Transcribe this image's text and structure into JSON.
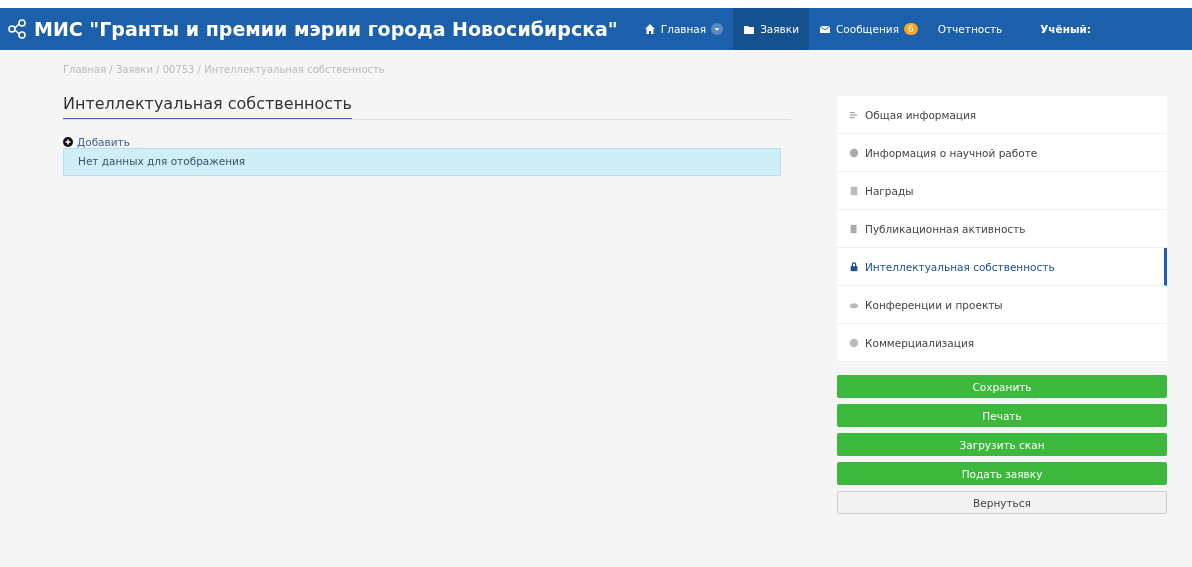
{
  "header": {
    "title": "МИС \"Гранты и премии мэрии города Новосибирска\"",
    "nav": [
      {
        "label": "Главная",
        "selected": false,
        "dropdown": true
      },
      {
        "label": "Заявки",
        "selected": true,
        "dropdown": false
      },
      {
        "label": "Сообщения",
        "selected": false,
        "dropdown": false,
        "badge": "6"
      },
      {
        "label": "Отчетность",
        "selected": false,
        "dropdown": false
      }
    ],
    "user": "Учёный:"
  },
  "breadcrumb": "Главная / Заявки / 00753 / Интеллектуальная собственность",
  "section_title": "Интеллектуальная собственность",
  "add_link": "Добавить",
  "empty_message": "Нет данных для отображения",
  "side_menu": [
    {
      "label": "Общая информация",
      "selected": false
    },
    {
      "label": "Информация о научной работе",
      "selected": false
    },
    {
      "label": "Награды",
      "selected": false
    },
    {
      "label": "Публикационная активность",
      "selected": false
    },
    {
      "label": "Интеллектуальная собственность",
      "selected": true
    },
    {
      "label": "Конференции и проекты",
      "selected": false
    },
    {
      "label": "Коммерциализация",
      "selected": false
    }
  ],
  "buttons": [
    {
      "label": "Сохранить",
      "kind": "primary"
    },
    {
      "label": "Печать",
      "kind": "primary"
    },
    {
      "label": "Загрузить скан",
      "kind": "primary"
    },
    {
      "label": "Подать заявку",
      "kind": "primary"
    },
    {
      "label": "Вернуться",
      "kind": "default"
    }
  ]
}
